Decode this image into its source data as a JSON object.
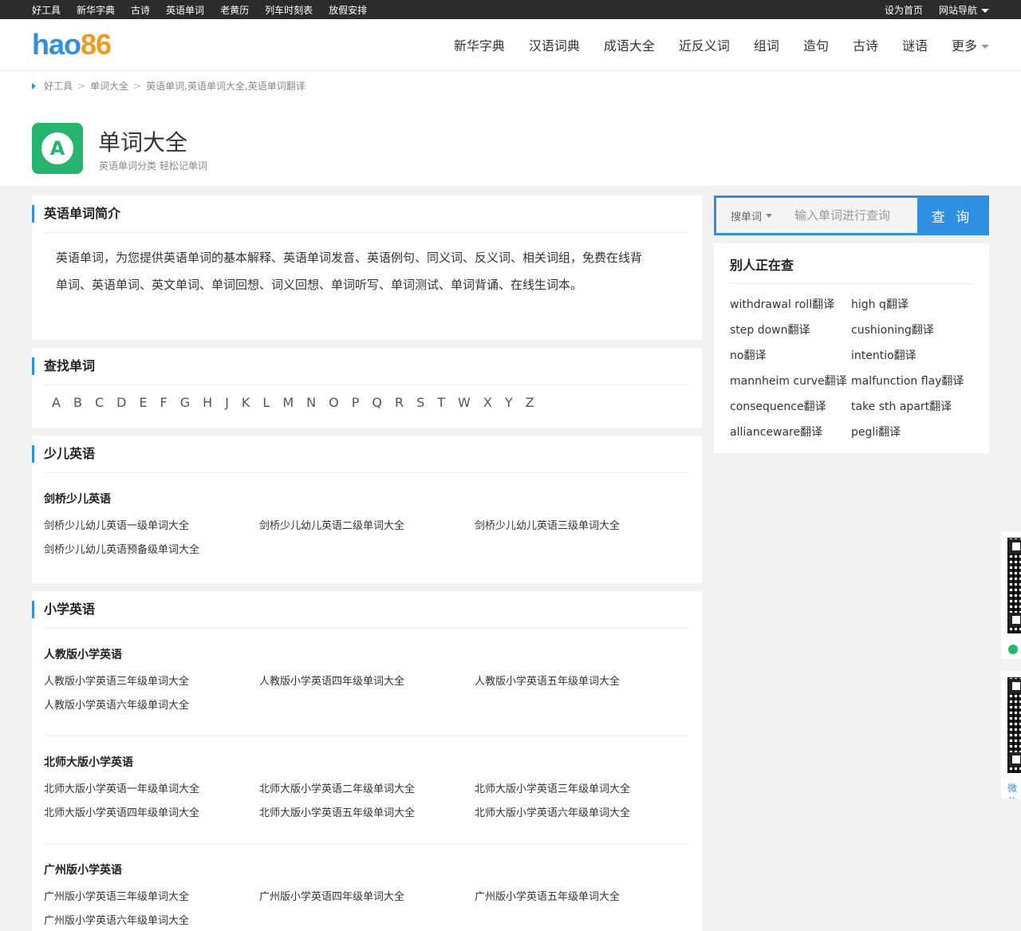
{
  "topbar": {
    "left": [
      "好工具",
      "新华字典",
      "古诗",
      "英语单词",
      "老黄历",
      "列车时刻表",
      "放假安排"
    ],
    "set_home": "设为首页",
    "site_nav": "网站导航"
  },
  "header": {
    "logo_a": "hao",
    "logo_b": "86",
    "nav": [
      "新华字典",
      "汉语词典",
      "成语大全",
      "近反义词",
      "组词",
      "造句",
      "古诗",
      "谜语"
    ],
    "more": "更多"
  },
  "breadcrumb": [
    "好工具",
    "单词大全",
    "英语单词,英语单词大全,英语单词翻译"
  ],
  "app": {
    "icon_letter": "A",
    "title": "单词大全",
    "subtitle": "英语单词分类 轻松记单词"
  },
  "intro": {
    "heading": "英语单词简介",
    "text": "英语单词，为您提供英语单词的基本解释、英语单词发音、英语例句、同义词、反义词、相关词组，免费在线背单词、英语单词、英文单词、单词回想、词义回想、单词听写、单词测试、单词背诵、在线生词本。"
  },
  "lookup": {
    "heading": "查找单词",
    "letters": [
      "A",
      "B",
      "C",
      "D",
      "E",
      "F",
      "G",
      "H",
      "J",
      "K",
      "L",
      "M",
      "N",
      "O",
      "P",
      "Q",
      "R",
      "S",
      "T",
      "W",
      "X",
      "Y",
      "Z"
    ]
  },
  "kids": {
    "heading": "少儿英语",
    "groups": [
      {
        "title": "剑桥少儿英语",
        "items": [
          "剑桥少儿幼儿英语一级单词大全",
          "剑桥少儿幼儿英语二级单词大全",
          "剑桥少儿幼儿英语三级单词大全",
          "剑桥少儿幼儿英语预备级单词大全"
        ]
      }
    ]
  },
  "primary": {
    "heading": "小学英语",
    "groups": [
      {
        "title": "人教版小学英语",
        "items": [
          "人教版小学英语三年级单词大全",
          "人教版小学英语四年级单词大全",
          "人教版小学英语五年级单词大全",
          "人教版小学英语六年级单词大全"
        ]
      },
      {
        "title": "北师大版小学英语",
        "items": [
          "北师大版小学英语一年级单词大全",
          "北师大版小学英语二年级单词大全",
          "北师大版小学英语三年级单词大全",
          "北师大版小学英语四年级单词大全",
          "北师大版小学英语五年级单词大全",
          "北师大版小学英语六年级单词大全"
        ]
      },
      {
        "title": "广州版小学英语",
        "items": [
          "广州版小学英语三年级单词大全",
          "广州版小学英语四年级单词大全",
          "广州版小学英语五年级单词大全",
          "广州版小学英语六年级单词大全"
        ]
      }
    ]
  },
  "search": {
    "type_label": "搜单词",
    "placeholder": "输入单词进行查询",
    "button": "查 询"
  },
  "recent": {
    "heading": "别人正在查",
    "items": [
      "withdrawal roll翻译",
      "high q翻译",
      "step down翻译",
      "cushioning翻译",
      "no翻译",
      "intentio翻译",
      "mannheim curve翻译",
      "malfunction flay翻译",
      "consequence翻译",
      "take sth apart翻译",
      "allianceware翻译",
      "pegli翻译"
    ]
  },
  "qr": {
    "wechat_label": "微信"
  },
  "colors": {
    "accent": "#2f8fe0",
    "green": "#27b46e",
    "topbar": "#2b2b2b"
  }
}
